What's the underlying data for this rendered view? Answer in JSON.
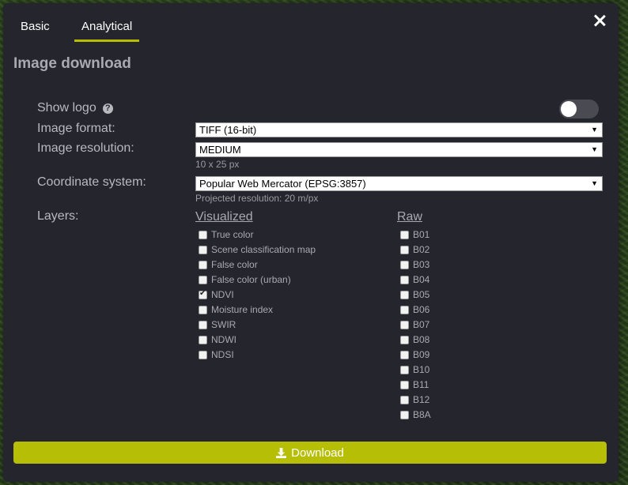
{
  "tabs": [
    {
      "label": "Basic"
    },
    {
      "label": "Analytical",
      "active": true
    }
  ],
  "title": "Image download",
  "fields": {
    "show_logo": {
      "label": "Show logo",
      "enabled": false
    },
    "image_format": {
      "label": "Image format:",
      "value": "TIFF (16-bit)"
    },
    "image_resolution": {
      "label": "Image resolution:",
      "value": "MEDIUM",
      "note": "10 x 25 px"
    },
    "coordinate_system": {
      "label": "Coordinate system:",
      "value": "Popular Web Mercator (EPSG:3857)",
      "note": "Projected resolution: 20 m/px"
    },
    "layers_label": "Layers:"
  },
  "layers": {
    "visualized_header": "Visualized",
    "raw_header": "Raw",
    "visualized": [
      {
        "label": "True color",
        "checked": false
      },
      {
        "label": "Scene classification map",
        "checked": false
      },
      {
        "label": "False color",
        "checked": false
      },
      {
        "label": "False color (urban)",
        "checked": false
      },
      {
        "label": "NDVI",
        "checked": true
      },
      {
        "label": "Moisture index",
        "checked": false
      },
      {
        "label": "SWIR",
        "checked": false
      },
      {
        "label": "NDWI",
        "checked": false
      },
      {
        "label": "NDSI",
        "checked": false
      }
    ],
    "raw": [
      {
        "label": "B01",
        "checked": false
      },
      {
        "label": "B02",
        "checked": false
      },
      {
        "label": "B03",
        "checked": false
      },
      {
        "label": "B04",
        "checked": false
      },
      {
        "label": "B05",
        "checked": false
      },
      {
        "label": "B06",
        "checked": false
      },
      {
        "label": "B07",
        "checked": false
      },
      {
        "label": "B08",
        "checked": false
      },
      {
        "label": "B09",
        "checked": false
      },
      {
        "label": "B10",
        "checked": false
      },
      {
        "label": "B11",
        "checked": false
      },
      {
        "label": "B12",
        "checked": false
      },
      {
        "label": "B8A",
        "checked": false
      }
    ]
  },
  "download_label": "Download",
  "icons": {
    "close": "close-icon",
    "help": "help-icon",
    "download": "download-icon"
  },
  "colors": {
    "accent": "#b6bf05",
    "panel": "#25252e"
  }
}
